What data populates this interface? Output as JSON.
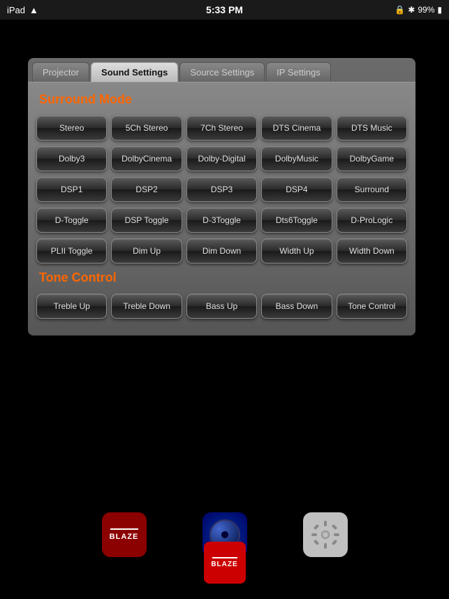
{
  "statusBar": {
    "deviceName": "iPad",
    "time": "5:33 PM",
    "battery": "99%"
  },
  "tabs": [
    {
      "id": "projector",
      "label": "Projector",
      "active": false
    },
    {
      "id": "sound-settings",
      "label": "Sound Settings",
      "active": true
    },
    {
      "id": "source-settings",
      "label": "Source Settings",
      "active": false
    },
    {
      "id": "ip-settings",
      "label": "IP Settings",
      "active": false
    }
  ],
  "soundSettings": {
    "surroundTitle": "Surround Mode",
    "toneTitle": "Tone Control",
    "rows": [
      [
        "Stereo",
        "5Ch Stereo",
        "7Ch Stereo",
        "DTS Cinema",
        "DTS Music"
      ],
      [
        "Dolby3",
        "DolbyCinema",
        "Dolby-Digital",
        "DolbyMusic",
        "DolbyGame"
      ],
      [
        "DSP1",
        "DSP2",
        "DSP3",
        "DSP4",
        "Surround"
      ],
      [
        "D-Toggle",
        "DSP Toggle",
        "D-3Toggle",
        "Dts6Toggle",
        "D-ProLogic"
      ],
      [
        "PLII Toggle",
        "Dim Up",
        "Dim Down",
        "Width Up",
        "Width Down"
      ]
    ],
    "toneRows": [
      [
        "Treble Up",
        "Treble Down",
        "Bass Up",
        "Bass Down",
        "Tone Control"
      ]
    ]
  },
  "dock": {
    "icons": [
      "blaze",
      "bluray",
      "settings"
    ]
  },
  "bottomBlaze": "BLAZE"
}
